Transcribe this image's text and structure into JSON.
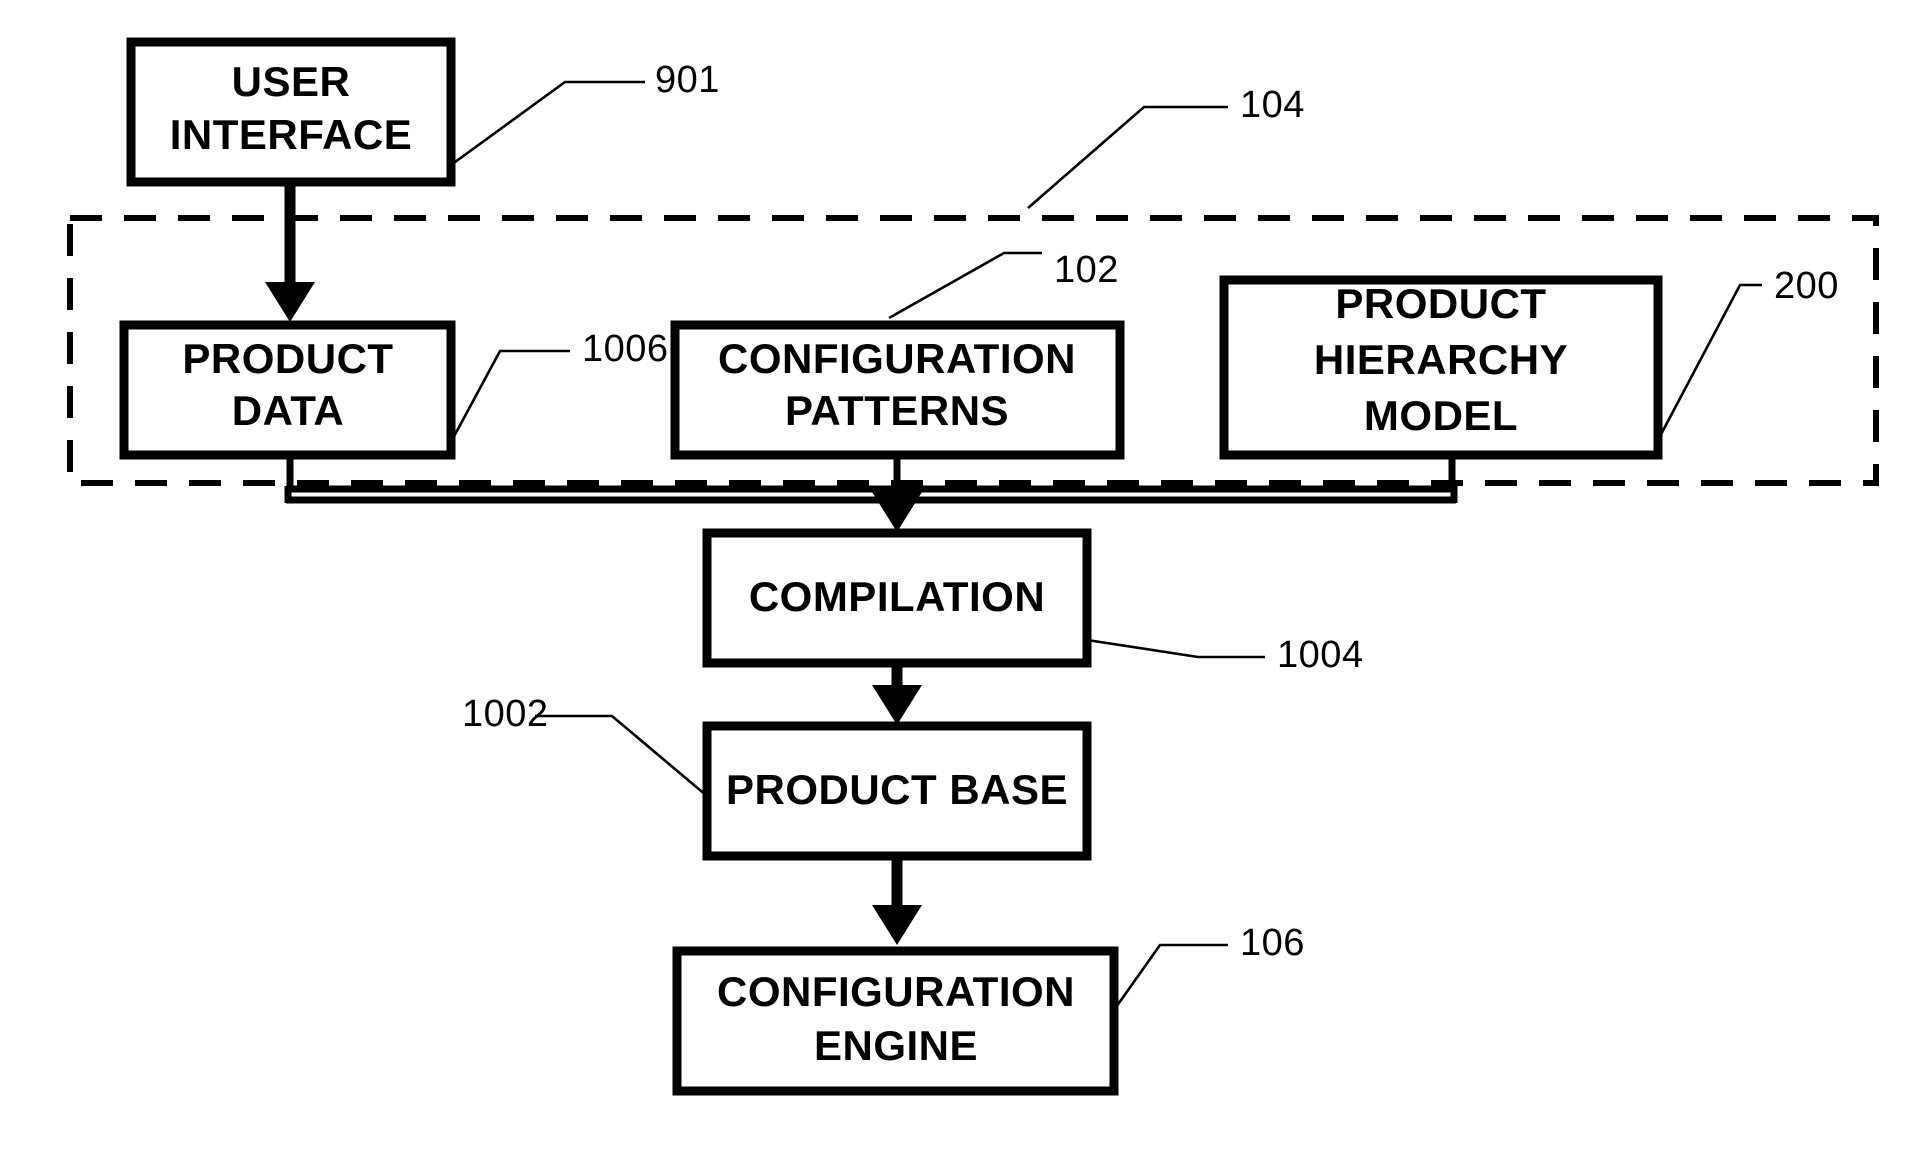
{
  "figure": {
    "type": "patent-block-diagram",
    "background_color": "#ffffff",
    "line_color": "#000000"
  },
  "boxes": {
    "user_interface": {
      "line1": "USER",
      "line2": "INTERFACE",
      "ref": "901"
    },
    "product_data": {
      "line1": "PRODUCT",
      "line2": "DATA",
      "ref": "1006"
    },
    "configuration_patterns": {
      "line1": "CONFIGURATION",
      "line2": "PATTERNS",
      "ref": "102"
    },
    "product_hierarchy_model": {
      "line1": "PRODUCT",
      "line2": "HIERARCHY",
      "line3": "MODEL",
      "ref": "200"
    },
    "compilation": {
      "line1": "COMPILATION",
      "ref": "1004"
    },
    "product_base": {
      "line1": "PRODUCT BASE",
      "ref": "1002"
    },
    "configuration_engine": {
      "line1": "CONFIGURATION",
      "line2": "ENGINE",
      "ref": "106"
    }
  },
  "group": {
    "name": "dashed-enclosure",
    "ref": "104",
    "border_style": "dashed"
  },
  "connections": [
    {
      "from": "user_interface",
      "to": "product_data",
      "style": "arrow"
    },
    {
      "from": "product_data",
      "to": "compilation",
      "style": "bus"
    },
    {
      "from": "configuration_patterns",
      "to": "compilation",
      "style": "bus-arrow"
    },
    {
      "from": "product_hierarchy_model",
      "to": "compilation",
      "style": "bus"
    },
    {
      "from": "compilation",
      "to": "product_base",
      "style": "arrow"
    },
    {
      "from": "product_base",
      "to": "configuration_engine",
      "style": "arrow"
    }
  ]
}
